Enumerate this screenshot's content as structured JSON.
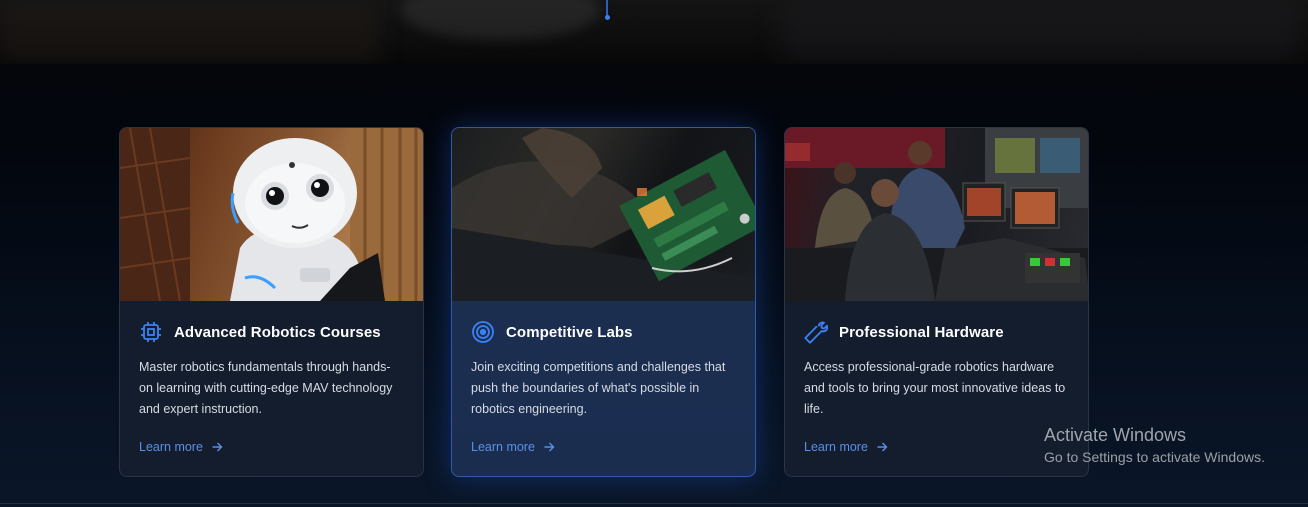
{
  "cards": [
    {
      "title": "Advanced Robotics Courses",
      "icon": "cpu-chip-icon",
      "description": "Master robotics fundamentals through hands-on learning with cutting-edge MAV technology and expert instruction.",
      "link_label": "Learn more"
    },
    {
      "title": "Competitive Labs",
      "icon": "target-icon",
      "description": "Join exciting competitions and challenges that push the boundaries of what's possible in robotics engineering.",
      "link_label": "Learn more"
    },
    {
      "title": "Professional Hardware",
      "icon": "wrench-icon",
      "description": "Access professional-grade robotics hardware and tools to bring your most innovative ideas to life.",
      "link_label": "Learn more"
    }
  ],
  "watermark": {
    "title": "Activate Windows",
    "subtitle": "Go to Settings to activate Windows."
  },
  "colors": {
    "accent": "#3b82f6",
    "link": "#5b8fe6",
    "card_bg": "#141d2d",
    "card_highlight_bg": "#1c2f52"
  }
}
